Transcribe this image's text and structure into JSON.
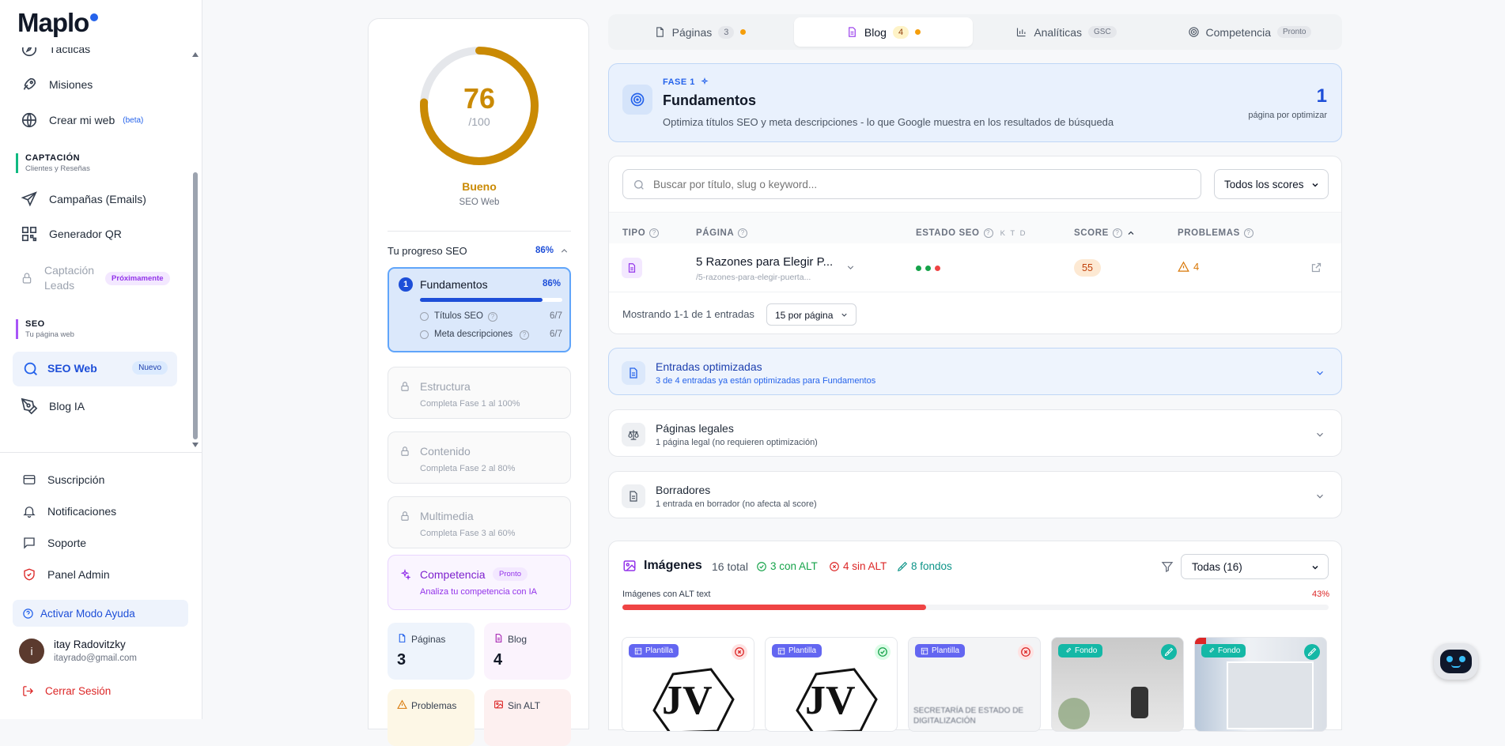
{
  "app": {
    "logo": "Maplo"
  },
  "sidebar": {
    "items_top": [
      {
        "label": "Tácticas",
        "icon": "compass-icon"
      },
      {
        "label": "Misiones",
        "icon": "rocket-icon"
      },
      {
        "label": "Crear mi web",
        "icon": "globe-icon",
        "badge": "(beta)"
      }
    ],
    "captacion": {
      "title": "CAPTACIÓN",
      "subtitle": "Clientes y Reseñas",
      "color": "#10b981"
    },
    "items_captacion": [
      {
        "label": "Campañas (Emails)",
        "icon": "send-icon"
      },
      {
        "label": "Generador QR",
        "icon": "qr-code-icon"
      },
      {
        "label": "Captación Leads",
        "label_line1": "Captación",
        "label_line2": "Leads",
        "icon": "lock-icon",
        "badge": "Próximamente"
      }
    ],
    "seo": {
      "title": "SEO",
      "subtitle": "Tu página web",
      "color": "#a855f7"
    },
    "items_seo": [
      {
        "label": "SEO Web",
        "icon": "search-icon",
        "badge": "Nuevo",
        "active": true
      },
      {
        "label": "Blog IA",
        "icon": "pen-tool-icon"
      }
    ],
    "bottom": [
      {
        "label": "Suscripción",
        "icon": "credit-card-icon"
      },
      {
        "label": "Notificaciones",
        "icon": "bell-icon"
      },
      {
        "label": "Soporte",
        "icon": "message-square-icon"
      },
      {
        "label": "Panel Admin",
        "icon": "shield-icon"
      }
    ],
    "help_mode": "Activar Modo Ayuda",
    "user": {
      "initial": "i",
      "name": "itay Radovitzky",
      "email": "itayrado@gmail.com"
    },
    "logout": "Cerrar Sesión"
  },
  "score_panel": {
    "score": "76",
    "max": "/100",
    "score_fraction": 0.76,
    "status": "Bueno",
    "label": "SEO Web",
    "progress_title": "Tu progreso SEO",
    "progress_pct": "86%",
    "phases": [
      {
        "num": "1",
        "title": "Fundamentos",
        "pct": "86%",
        "progress": 0.86,
        "subs": [
          {
            "label": "Títulos SEO",
            "value": "6/7"
          },
          {
            "label": "Meta descripciones",
            "value": "6/7"
          }
        ]
      },
      {
        "title": "Estructura",
        "desc": "Completa Fase 1 al 100%"
      },
      {
        "title": "Contenido",
        "desc": "Completa Fase 2 al 80%"
      },
      {
        "title": "Multimedia",
        "desc": "Completa Fase 3 al 60%"
      }
    ],
    "competencia": {
      "title": "Competencia",
      "badge": "Pronto",
      "desc": "Analiza tu competencia con IA"
    },
    "stats": [
      {
        "label": "Páginas",
        "value": "3"
      },
      {
        "label": "Blog",
        "value": "4"
      },
      {
        "label": "Problemas",
        "value": ""
      },
      {
        "label": "Sin ALT",
        "value": ""
      }
    ]
  },
  "tabs": [
    {
      "label": "Páginas",
      "count": "3"
    },
    {
      "label": "Blog",
      "count": "4"
    },
    {
      "label": "Analíticas",
      "count": "GSC"
    },
    {
      "label": "Competencia",
      "count": "Pronto"
    }
  ],
  "phase_banner": {
    "phase": "FASE 1",
    "title": "Fundamentos",
    "desc": "Optimiza títulos SEO y meta descripciones - lo que Google muestra en los resultados de búsqueda",
    "count": "1",
    "count_label": "página por optimizar"
  },
  "table": {
    "search_placeholder": "Buscar por título, slug o keyword...",
    "filter": "Todos los scores",
    "headers": {
      "tipo": "TIPO",
      "pagina": "PÁGINA",
      "estado": "ESTADO SEO",
      "estado_keys": "K T D",
      "score": "SCORE",
      "problemas": "PROBLEMAS"
    },
    "rows": [
      {
        "title": "5 Razones para Elegir P...",
        "slug": "/5-razones-para-elegir-puerta...",
        "score": "55",
        "problems": "4"
      }
    ],
    "footer": "Mostrando 1-1 de 1 entradas",
    "per_page": "15 por página"
  },
  "accordions": [
    {
      "title": "Entradas optimizadas",
      "desc": "3 de 4 entradas ya están optimizadas para Fundamentos",
      "icon": "file-text-icon"
    },
    {
      "title": "Páginas legales",
      "desc": "1 página legal (no requieren optimización)",
      "icon": "scale-icon"
    },
    {
      "title": "Borradores",
      "desc": "1 entrada en borrador (no afecta al score)",
      "icon": "file-text-icon"
    }
  ],
  "images": {
    "title": "Imágenes",
    "total": "16 total",
    "with_alt": "3 con ALT",
    "without_alt": "4 sin ALT",
    "backgrounds": "8 fondos",
    "filter": "Todas (16)",
    "alt_label": "Imágenes con ALT text",
    "alt_pct": "43%",
    "alt_fraction": 0.43,
    "cards": [
      {
        "tag": "Plantilla",
        "status": "missing",
        "caption": "JV"
      },
      {
        "tag": "Plantilla",
        "status": "ok",
        "caption": "JV"
      },
      {
        "tag": "Plantilla",
        "status": "missing",
        "caption": "SECRETARÍA DE ESTADO DE DIGITALIZACIÓN"
      },
      {
        "tag": "Fondo",
        "status": "bg",
        "caption": ""
      },
      {
        "tag": "Fondo",
        "status": "bg",
        "caption": ""
      }
    ]
  },
  "colors": {
    "accent": "#2563eb",
    "gold": "#ca8a04",
    "red": "#ef4444",
    "green": "#16a34a",
    "purple": "#9333ea"
  }
}
